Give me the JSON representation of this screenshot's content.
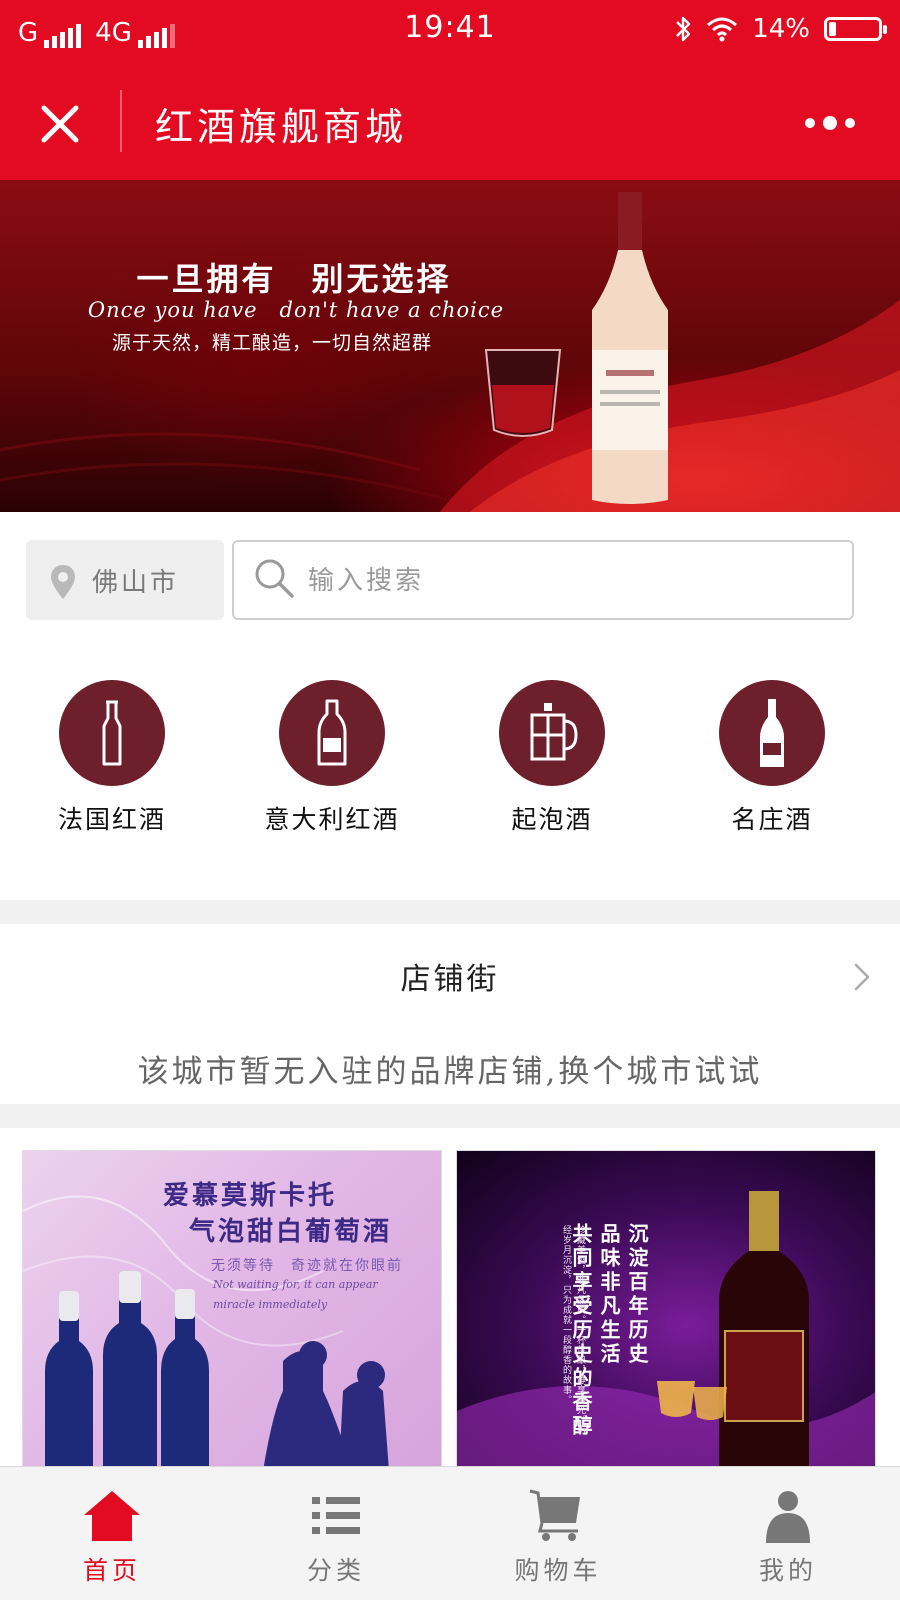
{
  "status_bar": {
    "carrier": "G",
    "network": "4G",
    "time": "19:41",
    "battery": "14%",
    "battery_level": 0.14
  },
  "navbar": {
    "title": "红酒旗舰商城",
    "close_icon": "close-icon",
    "more_icon": "more-icon"
  },
  "banner": {
    "headline": "一旦拥有　别无选择",
    "subtitle": "Once you have　don't have a choice",
    "tagline": "源于天然，精工酿造，一切自然超群"
  },
  "location": {
    "city": "佛山市",
    "icon": "location-pin-icon"
  },
  "search": {
    "placeholder": "输入搜索",
    "value": "",
    "icon": "search-icon"
  },
  "categories": [
    {
      "label": "法国红酒",
      "icon": "bottle-icon"
    },
    {
      "label": "意大利红酒",
      "icon": "wine-bottle-icon"
    },
    {
      "label": "起泡酒",
      "icon": "pitcher-icon"
    },
    {
      "label": "名庄酒",
      "icon": "labeled-bottle-icon"
    }
  ],
  "shop_street": {
    "title": "店铺街",
    "empty_message": "该城市暂无入驻的品牌店铺,换个城市试试"
  },
  "products": [
    {
      "title_line1": "爱慕莫斯卡托",
      "title_line2": "气泡甜白葡萄酒",
      "tagline": "无须等待　奇迹就在你眼前",
      "tagline_en": "Not waiting for, it can appear miracle immediately"
    },
    {
      "vertical_col1": "沉淀百年历史",
      "vertical_col2": "品味非凡生活",
      "vertical_col3": "共同享受历史的香醇",
      "body_text": "珍藏美酒，非凡品质。一杯佳酿，静享时光。历经岁月沉淀，只为成就一段醇香的故事。"
    }
  ],
  "tabbar": [
    {
      "label": "首页",
      "icon": "home-icon",
      "active": true
    },
    {
      "label": "分类",
      "icon": "list-icon",
      "active": false
    },
    {
      "label": "购物车",
      "icon": "cart-icon",
      "active": false
    },
    {
      "label": "我的",
      "icon": "user-icon",
      "active": false
    }
  ],
  "colors": {
    "brand_red": "#e30b22",
    "category_circle": "#6d1f2c",
    "tab_active": "#e30b22",
    "tab_inactive": "#777777"
  }
}
